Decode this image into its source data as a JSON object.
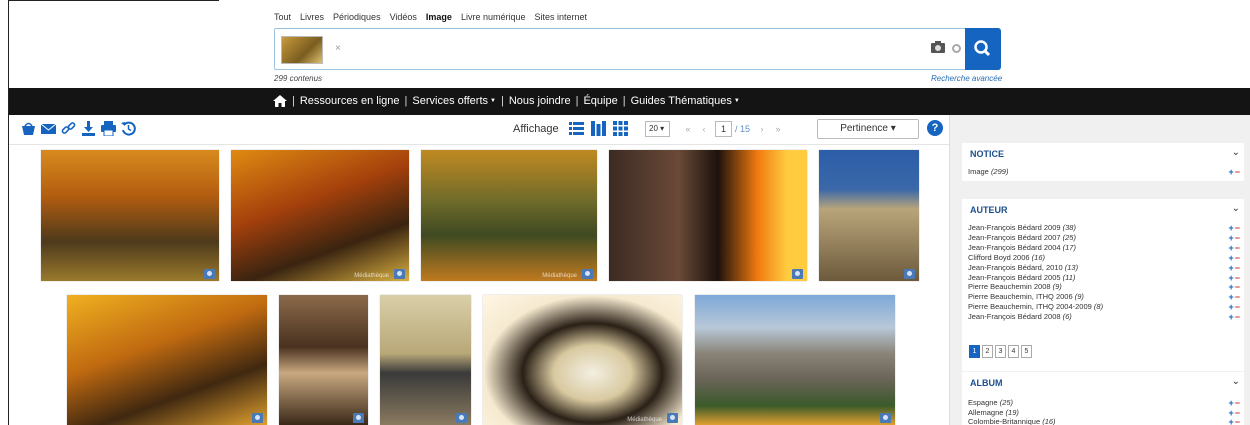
{
  "filters": [
    "Tout",
    "Livres",
    "Périodiques",
    "Vidéos",
    "Image",
    "Livre numérique",
    "Sites internet"
  ],
  "active_filter": "Image",
  "search": {
    "remove_label": "×",
    "result_count": "299 contenus",
    "advanced_link": "Recherche avancée"
  },
  "nav": {
    "items": [
      {
        "label": "Ressources en ligne",
        "dropdown": false
      },
      {
        "label": "Services offerts",
        "dropdown": true
      },
      {
        "label": "Nous joindre",
        "dropdown": false
      },
      {
        "label": "Équipe",
        "dropdown": false
      },
      {
        "label": "Guides Thématiques",
        "dropdown": true
      }
    ]
  },
  "toolbar": {
    "tools": [
      "basket-icon",
      "email-icon",
      "link-icon",
      "download-icon",
      "print-icon",
      "history-icon"
    ],
    "display_label": "Affichage",
    "per_page": "20 ▾",
    "page_current": "1",
    "page_total": "/ 15",
    "sort_label": "Pertinence ▾",
    "help": "?"
  },
  "images": [
    {
      "name": "autumn-fence-road",
      "bg": "linear-gradient(180deg,#d88a1e 0%,#b35d10 35%,#4d3a1c 70%,#9a7a2c 100%)"
    },
    {
      "name": "autumn-tree-alley",
      "bg": "linear-gradient(160deg,#e08a12 0%,#a4400c 40%,#3a2410 70%,#d9b040 100%)",
      "wm": "Médiathèque"
    },
    {
      "name": "autumn-house-forest",
      "bg": "linear-gradient(180deg,#c08a22 0%,#6d6a2a 40%,#3f4a22 65%,#c07a20 100%)",
      "wm": "Médiathèque"
    },
    {
      "name": "couple-fireplace",
      "bg": "linear-gradient(90deg,#3b2a22 0%,#6a4a38 35%,#1c120c 55%,#f07a10 75%,#ffcc40 90%)"
    },
    {
      "name": "church-facade",
      "bg": "linear-gradient(180deg,#2c5da8 0%,#3a68a8 30%,#b9a57a 45%,#6d5a3c 100%)"
    },
    {
      "name": "autumn-forest-road",
      "bg": "linear-gradient(160deg,#f0b020 0%,#c06a10 40%,#402810 70%,#e0a030 100%)"
    },
    {
      "name": "heraldic-engraving",
      "bg": "linear-gradient(180deg,#8b6a4a 0%,#4a3220 40%,#c8a880 60%,#3a2818 100%)"
    },
    {
      "name": "interior-white-horse",
      "bg": "linear-gradient(180deg,#d9cfa8 0%,#b8a878 45%,#3a3a3a 60%,#8a7a60 100%)"
    },
    {
      "name": "rice-bowl",
      "bg": "radial-gradient(ellipse at 55% 60%,#f4efe2 0%,#d8c9a0 25%,#2a2016 45%,#f6ead0 70%,#fff6e4 100%)",
      "wm": "Médiathèque"
    },
    {
      "name": "mountain-valley",
      "bg": "linear-gradient(180deg,#7ea8d8 0%,#b8c8d8 25%,#8a8478 45%,#6a6458 65%,#3a5a2a 85%,#e0a030 100%)"
    }
  ],
  "sidebar": {
    "notice": {
      "title": "NOTICE",
      "items": [
        {
          "label": "Image",
          "count": "(299)"
        }
      ]
    },
    "auteur": {
      "title": "AUTEUR",
      "items": [
        {
          "label": "Jean-François Bédard 2009",
          "count": "(38)"
        },
        {
          "label": "Jean-François Bédard 2007",
          "count": "(25)"
        },
        {
          "label": "Jean-François Bédard 2004",
          "count": "(17)"
        },
        {
          "label": "Clifford Boyd 2006",
          "count": "(16)"
        },
        {
          "label": "Jean-François Bédard, 2010",
          "count": "(13)"
        },
        {
          "label": "Jean-François Bédard 2005",
          "count": "(11)"
        },
        {
          "label": "Pierre Beauchemin 2008",
          "count": "(9)"
        },
        {
          "label": "Pierre Beauchemin, ITHQ 2006",
          "count": "(9)"
        },
        {
          "label": "Pierre Beauchemin, ITHQ 2004-2009",
          "count": "(8)"
        },
        {
          "label": "Jean-François Bédard 2008",
          "count": "(6)"
        }
      ],
      "pages": [
        "1",
        "2",
        "3",
        "4",
        "5"
      ]
    },
    "album": {
      "title": "ALBUM",
      "items": [
        {
          "label": "Espagne",
          "count": "(25)"
        },
        {
          "label": "Allemagne",
          "count": "(19)"
        },
        {
          "label": "Colombie-Britannique",
          "count": "(16)"
        }
      ]
    }
  }
}
